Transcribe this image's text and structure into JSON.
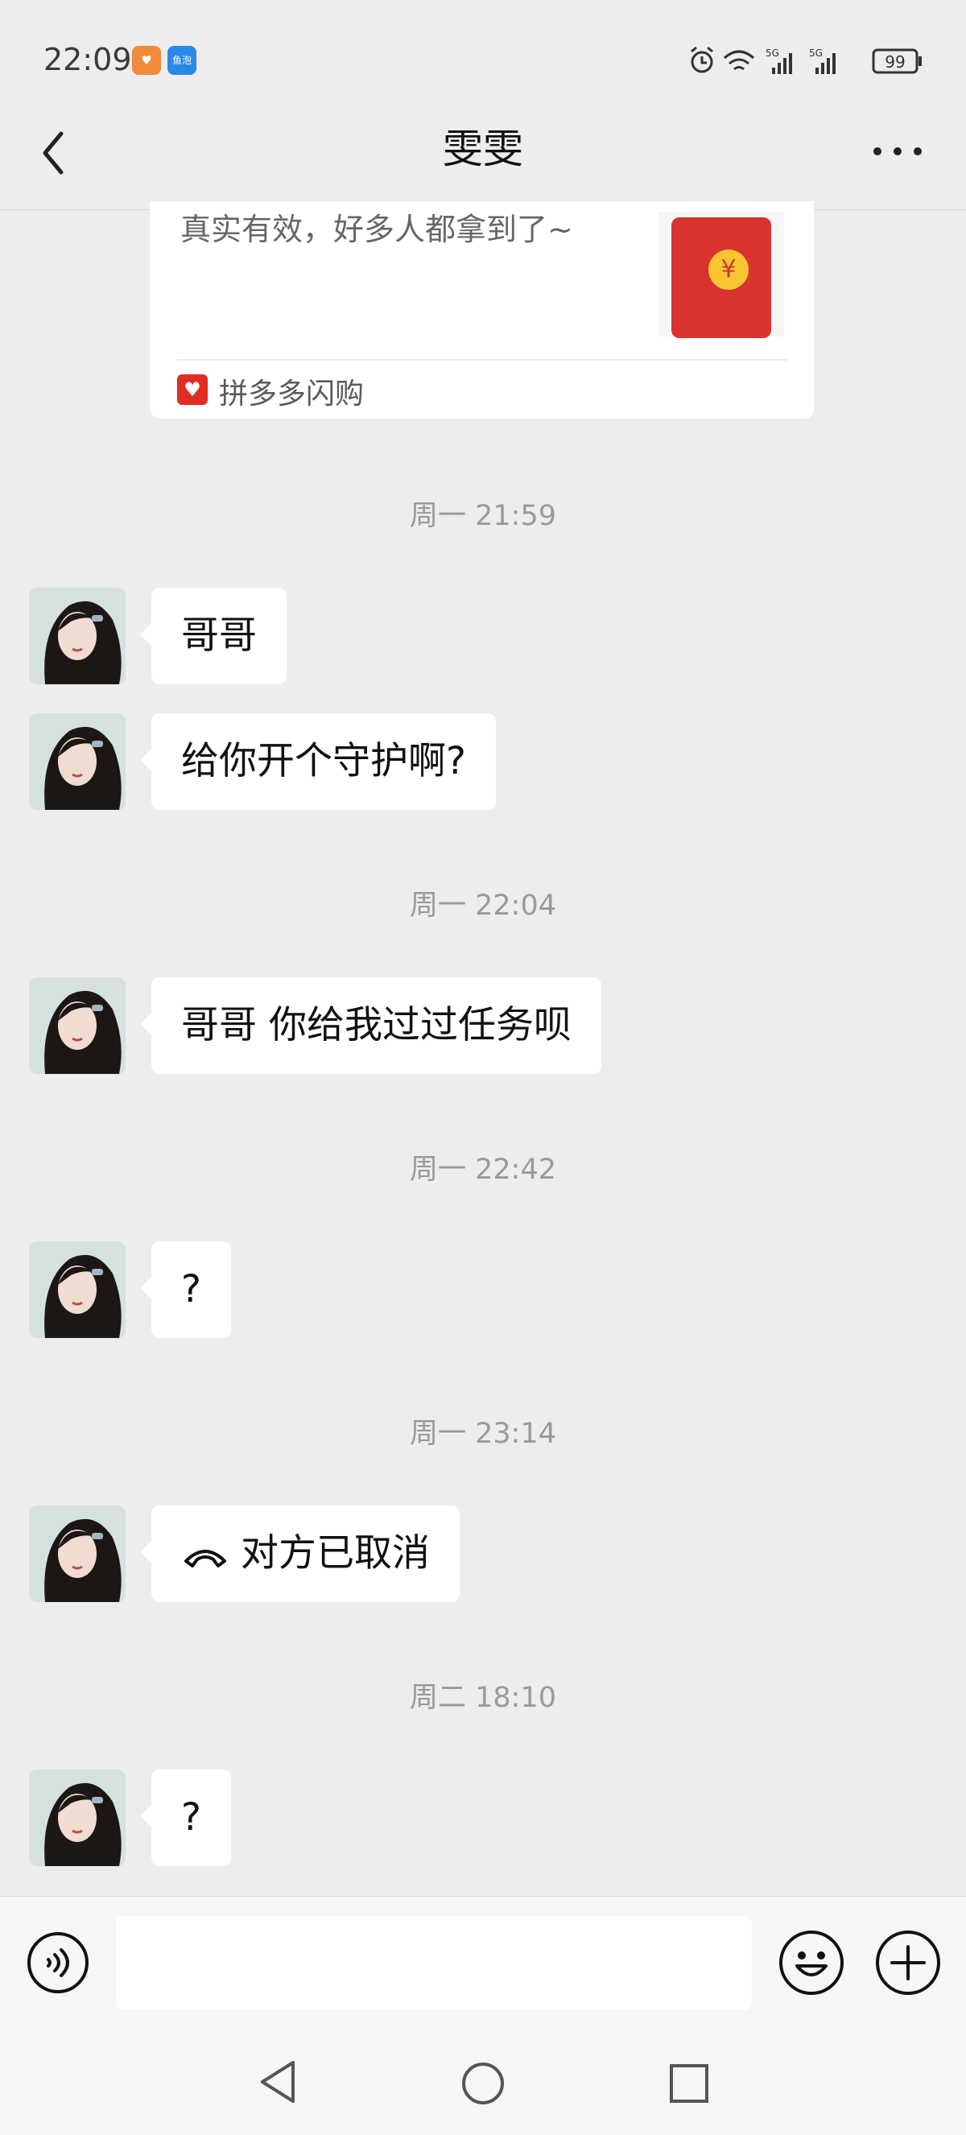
{
  "status_bar": {
    "time": "22:09",
    "app_badge_1": "♥",
    "app_badge_2": "鱼泡",
    "battery": "99",
    "signal_1": "5G",
    "signal_2": "5G"
  },
  "header": {
    "title": "雯雯"
  },
  "card": {
    "text": "真实有效，好多人都拿到了~",
    "coin": "¥",
    "source": "拼多多闪购",
    "source_icon": "♥"
  },
  "messages": [
    {
      "time": "周一 21:59"
    },
    {
      "text": "哥哥"
    },
    {
      "text": "给你开个守护啊?"
    },
    {
      "time": "周一 22:04"
    },
    {
      "text": "哥哥 你给我过过任务呗"
    },
    {
      "time": "周一 22:42"
    },
    {
      "text": "?"
    },
    {
      "time": "周一 23:14"
    },
    {
      "text": "对方已取消",
      "icon": "phone-hangup-icon"
    },
    {
      "time": "周二 18:10"
    },
    {
      "text": "?"
    }
  ],
  "input": {
    "placeholder": "",
    "value": ""
  },
  "colors": {
    "background": "#ededed",
    "bubble": "#ffffff",
    "red_packet": "#d8332e",
    "coin": "#f7c531",
    "timestamp": "#9a9a9a"
  }
}
